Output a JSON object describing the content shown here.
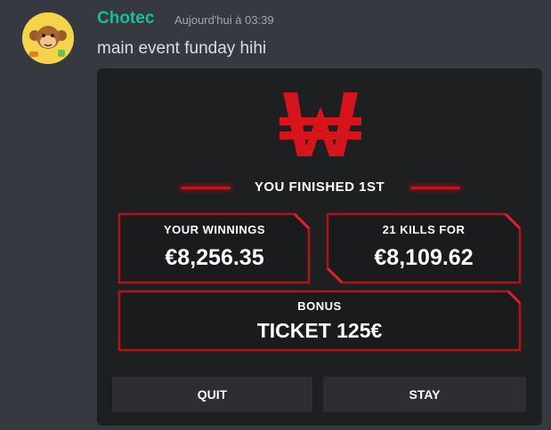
{
  "message": {
    "author": "Chotec",
    "timestamp": "Aujourd'hui à 03:39",
    "text": "main event funday hihi",
    "avatar_icon": "monkey-avatar-icon"
  },
  "embed": {
    "logo_icon": "won-sign-logo-icon",
    "headline": "YOU FINISHED 1ST",
    "winnings": {
      "label": "YOUR WINNINGS",
      "value": "€8,256.35"
    },
    "kills": {
      "label": "21 KILLS FOR",
      "value": "€8,109.62"
    },
    "bonus": {
      "label": "BONUS",
      "value": "TICKET 125€"
    },
    "buttons": {
      "quit": "QUIT",
      "stay": "STAY"
    },
    "colors": {
      "accent": "#d6141c",
      "background": "#1e1f21",
      "button": "#2c2e31"
    }
  },
  "colors": {
    "author": "#1abc9c",
    "message_text": "#dcddde",
    "timestamp": "#a3a6aa",
    "chat_bg": "#36393f"
  }
}
